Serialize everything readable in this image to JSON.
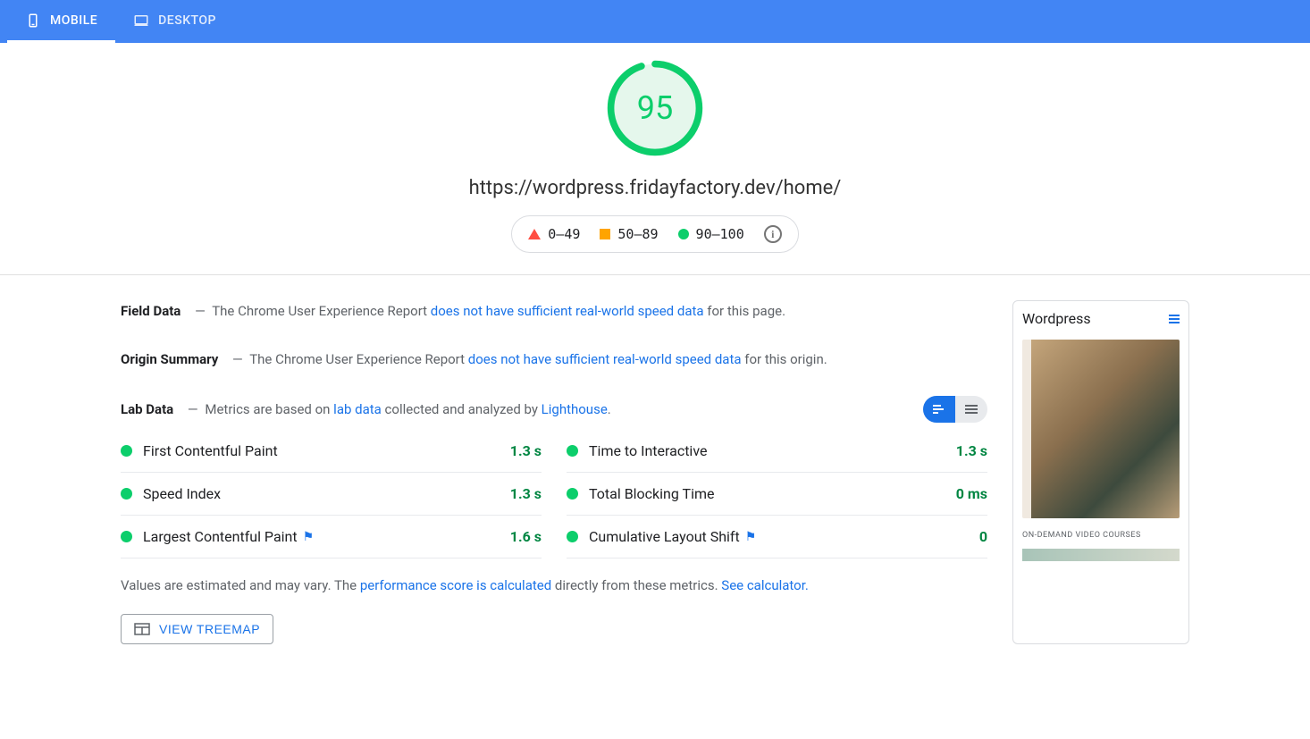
{
  "tabs": {
    "mobile": "MOBILE",
    "desktop": "DESKTOP"
  },
  "score": "95",
  "url": "https://wordpress.fridayfactory.dev/home/",
  "legend": {
    "low": "0–49",
    "mid": "50–89",
    "high": "90–100"
  },
  "field_data": {
    "title": "Field Data",
    "pre": "The Chrome User Experience Report ",
    "link": "does not have sufficient real-world speed data",
    "post": " for this page."
  },
  "origin_summary": {
    "title": "Origin Summary",
    "pre": "The Chrome User Experience Report ",
    "link": "does not have sufficient real-world speed data",
    "post": " for this origin."
  },
  "lab_data": {
    "title": "Lab Data",
    "pre": "Metrics are based on ",
    "link1": "lab data",
    "mid": " collected and analyzed by ",
    "link2": "Lighthouse",
    "post": "."
  },
  "metrics": {
    "fcp": {
      "name": "First Contentful Paint",
      "value": "1.3 s"
    },
    "si": {
      "name": "Speed Index",
      "value": "1.3 s"
    },
    "lcp": {
      "name": "Largest Contentful Paint",
      "value": "1.6 s"
    },
    "tti": {
      "name": "Time to Interactive",
      "value": "1.3 s"
    },
    "tbt": {
      "name": "Total Blocking Time",
      "value": "0 ms"
    },
    "cls": {
      "name": "Cumulative Layout Shift",
      "value": "0"
    }
  },
  "footnote": {
    "pre": "Values are estimated and may vary. The ",
    "link1": "performance score is calculated",
    "mid": " directly from these metrics. ",
    "link2": "See calculator."
  },
  "treemap_label": "VIEW TREEMAP",
  "preview": {
    "title": "Wordpress",
    "caption": "ON-DEMAND VIDEO COURSES"
  }
}
